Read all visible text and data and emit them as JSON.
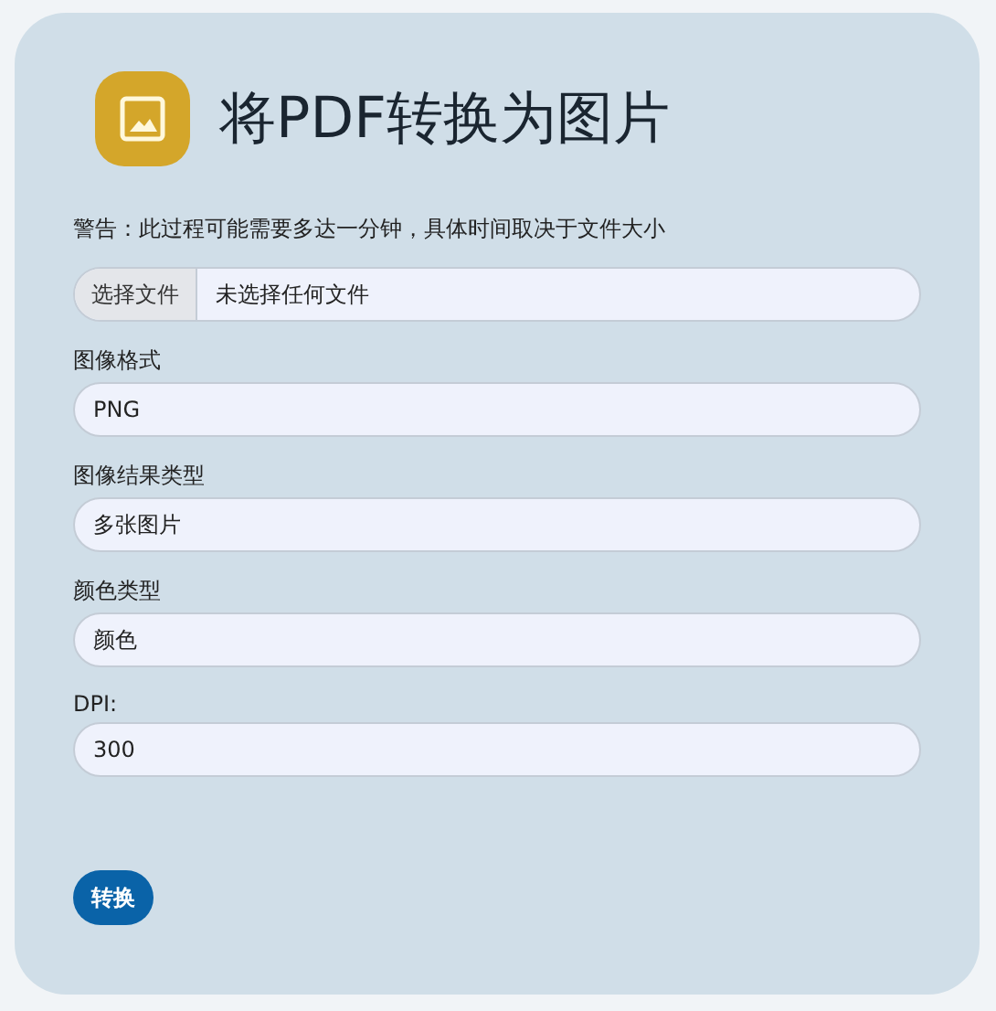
{
  "title": "将PDF转换为图片",
  "warning": "警告：此过程可能需要多达一分钟，具体时间取决于文件大小",
  "file_input": {
    "button": "选择文件",
    "status": "未选择任何文件"
  },
  "fields": [
    {
      "label": "图像格式",
      "value": "PNG"
    },
    {
      "label": "图像结果类型",
      "value": "多张图片"
    },
    {
      "label": "颜色类型",
      "value": "颜色"
    },
    {
      "label": "DPI:",
      "value": "300"
    }
  ],
  "submit": "转换"
}
